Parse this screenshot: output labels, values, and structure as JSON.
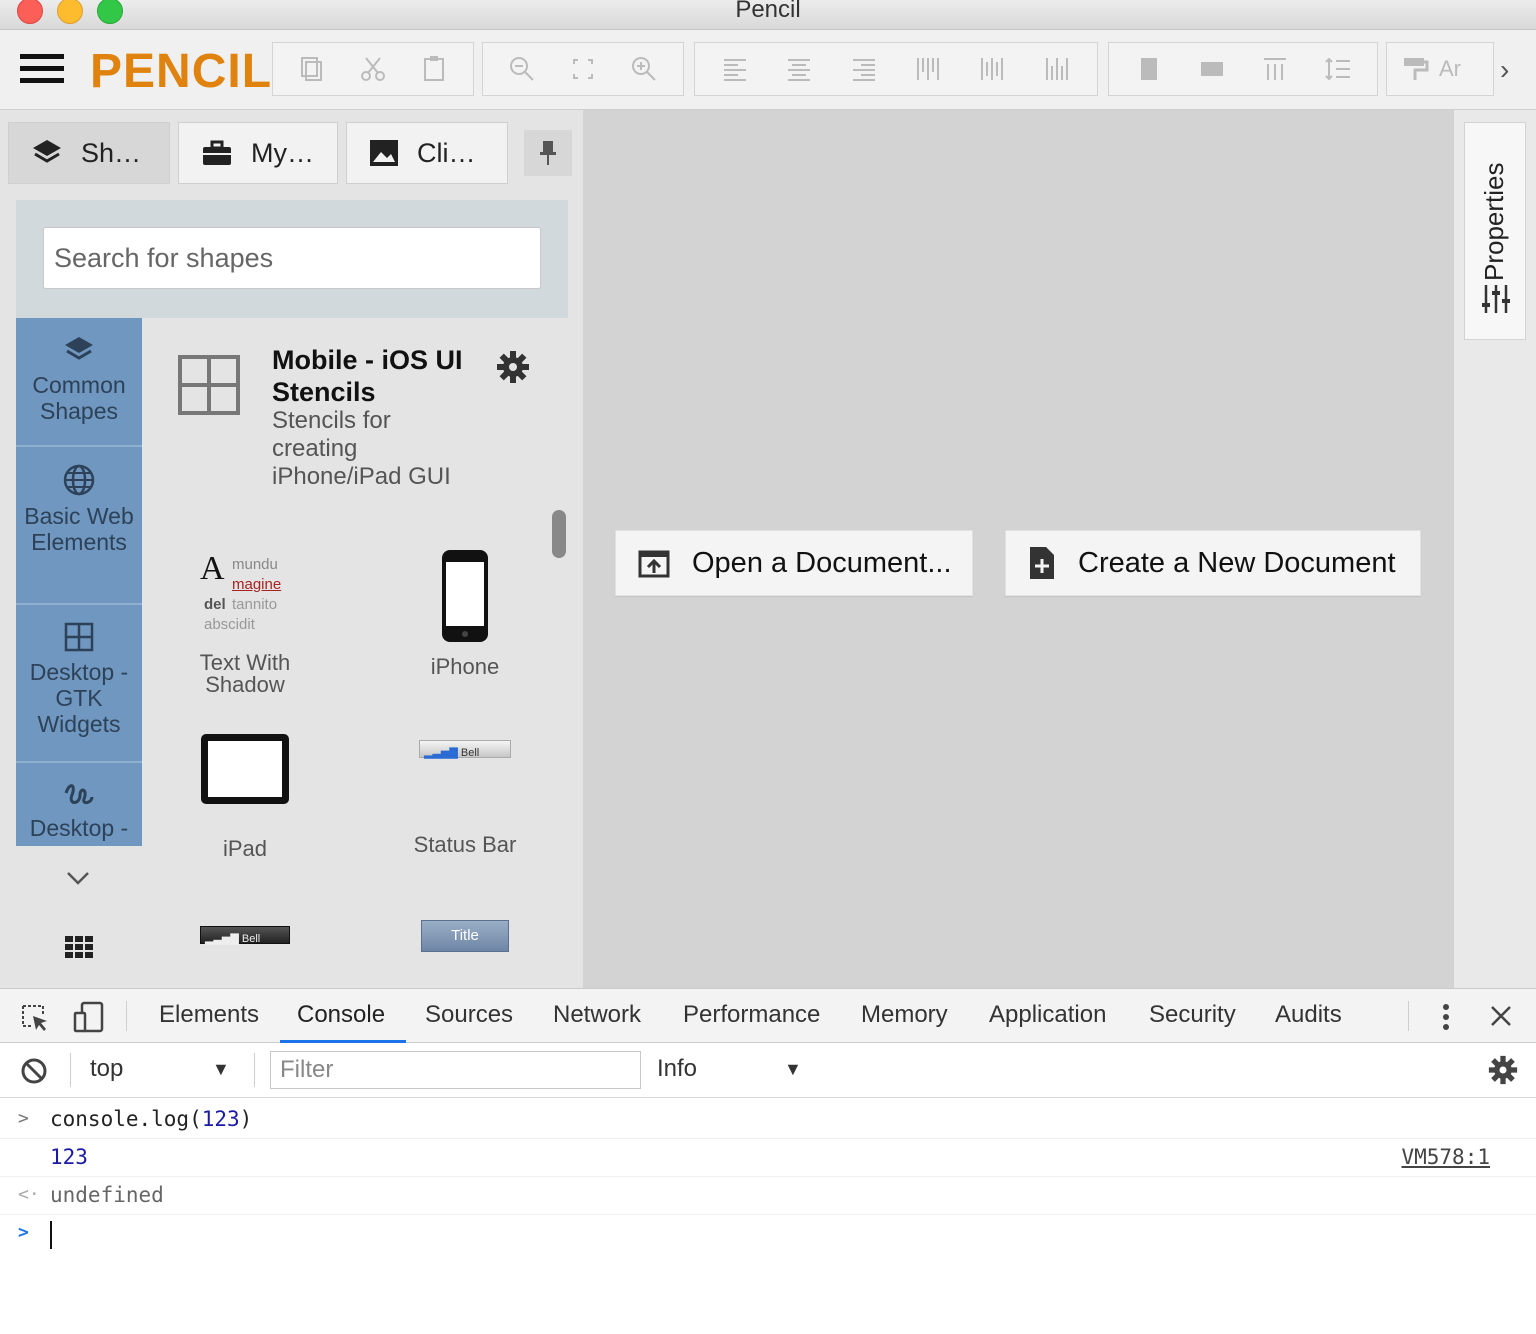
{
  "window": {
    "title": "Pencil"
  },
  "toolbar": {
    "logo": "PENCIL",
    "font_field": "Ar"
  },
  "left_tabs": [
    {
      "label": "Sh…",
      "icon": "layers-icon",
      "active": true
    },
    {
      "label": "My…",
      "icon": "briefcase-icon",
      "active": false
    },
    {
      "label": "Cli…",
      "icon": "image-icon",
      "active": false
    }
  ],
  "search": {
    "placeholder": "Search for shapes"
  },
  "categories": [
    {
      "label": "Common Shapes",
      "icon": "layers-icon"
    },
    {
      "label": "Basic Web Elements",
      "icon": "globe-icon"
    },
    {
      "label": "Desktop - GTK Widgets",
      "icon": "grid-icon"
    },
    {
      "label": "Desktop -",
      "icon": "squiggle-icon"
    }
  ],
  "collection": {
    "title": "Mobile - iOS UI Stencils",
    "description": "Stencils for creating iPhone/iPad GUI"
  },
  "shapes": [
    {
      "label": "Text With Shadow",
      "preview_words": [
        "mundu",
        "magine",
        "del",
        "tannito",
        "abscidit"
      ]
    },
    {
      "label": "iPhone"
    },
    {
      "label": "iPad"
    },
    {
      "label": "Status Bar",
      "preview_text": "Bell"
    },
    {
      "label": "",
      "preview_text": "Bell"
    },
    {
      "label": "",
      "preview_text": "Title"
    }
  ],
  "canvas": {
    "open_button": "Open a Document...",
    "create_button": "Create a New Document"
  },
  "properties": {
    "label": "Properties"
  },
  "devtools": {
    "tabs": [
      "Elements",
      "Console",
      "Sources",
      "Network",
      "Performance",
      "Memory",
      "Application",
      "Security",
      "Audits"
    ],
    "active_tab": "Console",
    "context": "top",
    "filter_placeholder": "Filter",
    "level": "Info",
    "console": {
      "input": "console.log(",
      "input_arg": "123",
      "input_close": ")",
      "output": "123",
      "source": "VM578:1",
      "result": "undefined"
    }
  },
  "colors": {
    "accent": "#e0820e",
    "category_bg": "#6f97bf",
    "devtools_active": "#1a73e8"
  }
}
